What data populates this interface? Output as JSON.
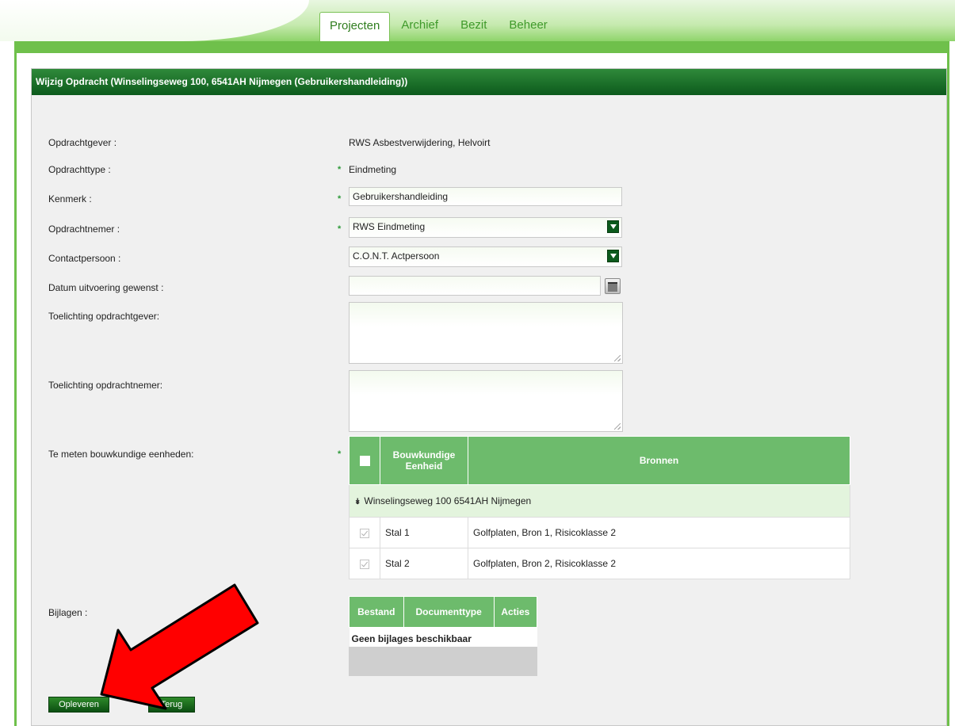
{
  "nav": {
    "tabs": [
      {
        "label": "Projecten",
        "active": true
      },
      {
        "label": "Archief",
        "active": false
      },
      {
        "label": "Bezit",
        "active": false
      },
      {
        "label": "Beheer",
        "active": false
      }
    ]
  },
  "panel": {
    "title": "Wijzig Opdracht (Winselingseweg 100, 6541AH Nijmegen (Gebruikershandleiding))"
  },
  "form": {
    "opdrachtgever": {
      "label": "Opdrachtgever :",
      "value": "RWS Asbestverwijdering, Helvoirt"
    },
    "opdrachttype": {
      "label": "Opdrachttype :",
      "value": "Eindmeting"
    },
    "kenmerk": {
      "label": "Kenmerk :",
      "value": "Gebruikershandleiding"
    },
    "opdrachtnemer": {
      "label": "Opdrachtnemer :",
      "value": "RWS Eindmeting"
    },
    "contactpersoon": {
      "label": "Contactpersoon :",
      "value": "C.O.N.T.  Actpersoon"
    },
    "datum": {
      "label": "Datum uitvoering gewenst :",
      "value": ""
    },
    "toelichting_gever": {
      "label": "Toelichting opdrachtgever:",
      "value": ""
    },
    "toelichting_nemer": {
      "label": "Toelichting opdrachtnemer:",
      "value": ""
    },
    "eenheden": {
      "label": "Te meten bouwkundige eenheden:"
    },
    "bijlagen": {
      "label": "Bijlagen :"
    },
    "required_marker": "*"
  },
  "units_table": {
    "headers": {
      "unit_line1": "Bouwkundige",
      "unit_line2": "Eenheid",
      "sources": "Bronnen"
    },
    "group": "Winselingseweg 100 6541AH Nijmegen",
    "group_icon": "double-chevron-down-icon",
    "rows": [
      {
        "unit": "Stal 1",
        "source": "Golfplaten, Bron 1, Risicoklasse 2",
        "checked": true
      },
      {
        "unit": "Stal 2",
        "source": "Golfplaten, Bron 2, Risicoklasse 2",
        "checked": true
      }
    ]
  },
  "attachments": {
    "headers": [
      "Bestand",
      "Documenttype",
      "Acties"
    ],
    "empty_text": "Geen bijlages beschikbaar"
  },
  "buttons": {
    "submit": "Opleveren",
    "back": "Terug"
  },
  "colors": {
    "header_green": "#0c5a1c",
    "table_header": "#6dbb6c",
    "frame_green": "#6fc04b",
    "arrow_red": "#ff0000"
  }
}
